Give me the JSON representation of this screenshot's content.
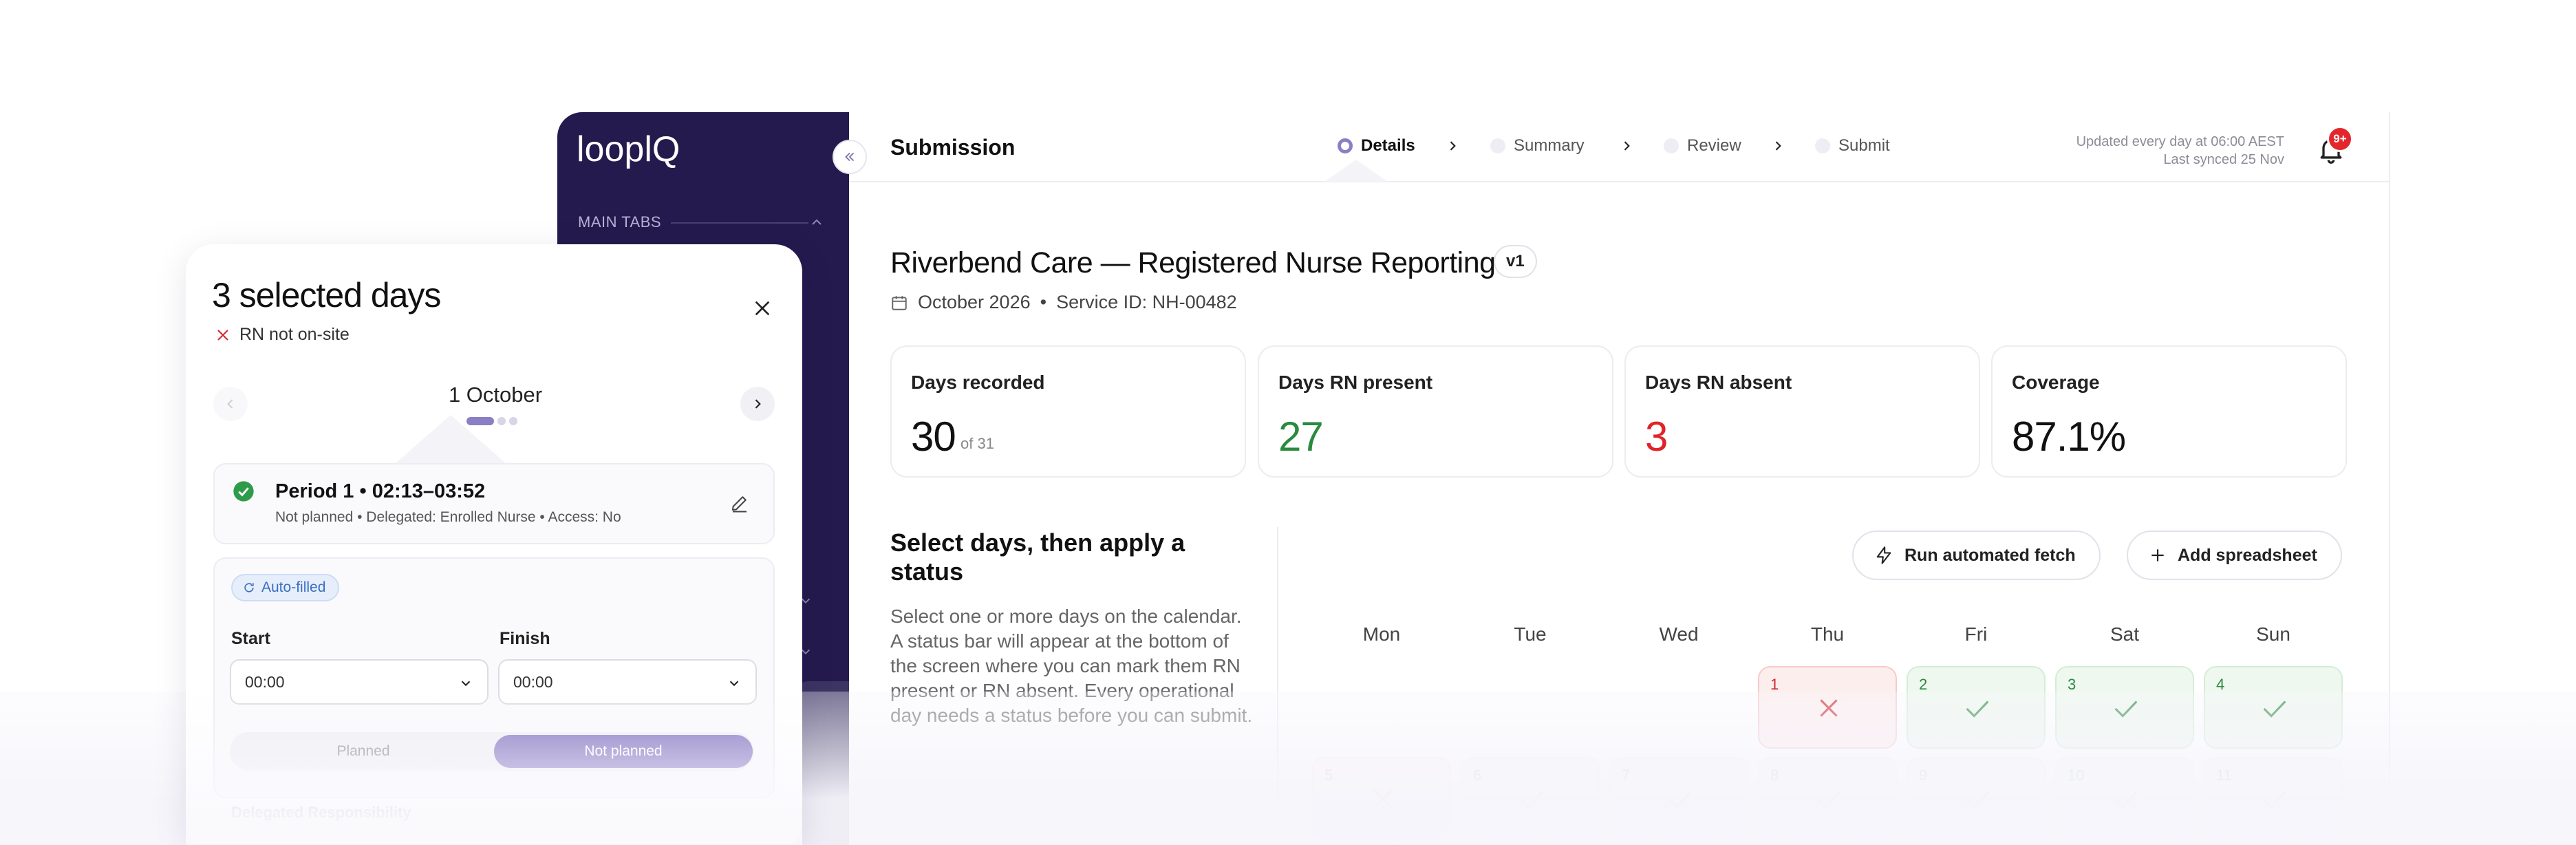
{
  "app": {
    "brand": "looplQ",
    "page_title": "Submission"
  },
  "sidebar": {
    "main_tabs_label": "MAIN TABS"
  },
  "stepper": {
    "steps": [
      {
        "label": "Details",
        "active": true
      },
      {
        "label": "Summary",
        "active": false
      },
      {
        "label": "Review",
        "active": false
      },
      {
        "label": "Submit",
        "active": false
      }
    ]
  },
  "status": {
    "updated": "Updated every day at 06:00 AEST",
    "last_synced": "Last synced 25 Nov",
    "notifications_badge": "9+"
  },
  "report": {
    "title": "Riverbend Care — Registered Nurse Reporting",
    "version": "v1",
    "period": "October 2026",
    "service_id": "Service ID: NH-00482"
  },
  "stats": [
    {
      "label": "Days recorded",
      "value": "30",
      "sub": "of 31"
    },
    {
      "label": "Days RN present",
      "value": "27"
    },
    {
      "label": "Days RN absent",
      "value": "3"
    },
    {
      "label": "Coverage",
      "value": "87.1%"
    }
  ],
  "calendar_section": {
    "heading": "Select days, then apply a status",
    "body": "Select one or more days on the calendar. A status bar will appear at the bottom of the screen where you can mark them RN present or RN absent. Every operational day needs a status before you can submit.",
    "run_fetch_label": "Run automated fetch",
    "add_sheet_label": "Add spreadsheet",
    "weekdays": [
      "Mon",
      "Tue",
      "Wed",
      "Thu",
      "Fri",
      "Sat",
      "Sun"
    ],
    "row1": [
      {
        "num": "1",
        "status": "absent"
      },
      {
        "num": "2",
        "status": "present"
      },
      {
        "num": "3",
        "status": "present"
      },
      {
        "num": "4",
        "status": "present"
      }
    ],
    "row2": [
      {
        "num": "5",
        "status": "absent"
      },
      {
        "num": "6",
        "status": "present"
      },
      {
        "num": "7",
        "status": "present"
      },
      {
        "num": "8",
        "status": "present"
      },
      {
        "num": "9",
        "status": "present"
      },
      {
        "num": "10",
        "status": "present"
      },
      {
        "num": "11",
        "status": "present"
      }
    ]
  },
  "panel": {
    "title": "3 selected days",
    "subtitle": "RN not on-site",
    "date": "1 October",
    "period_title": "Period 1  •  02:13–03:52",
    "period_meta": "Not planned  •  Delegated: Enrolled Nurse  •  Access: No",
    "auto_filled": "Auto-filled",
    "start_label": "Start",
    "finish_label": "Finish",
    "start_value": "00:00",
    "finish_value": "00:00",
    "seg_planned": "Planned",
    "seg_not_planned": "Not planned",
    "delegated_heading": "Delegated Responsibility"
  },
  "colors": {
    "sidebar": "#241a4d",
    "accent": "#8a7fc4",
    "present": "#2a8a3e",
    "absent": "#e12229"
  }
}
